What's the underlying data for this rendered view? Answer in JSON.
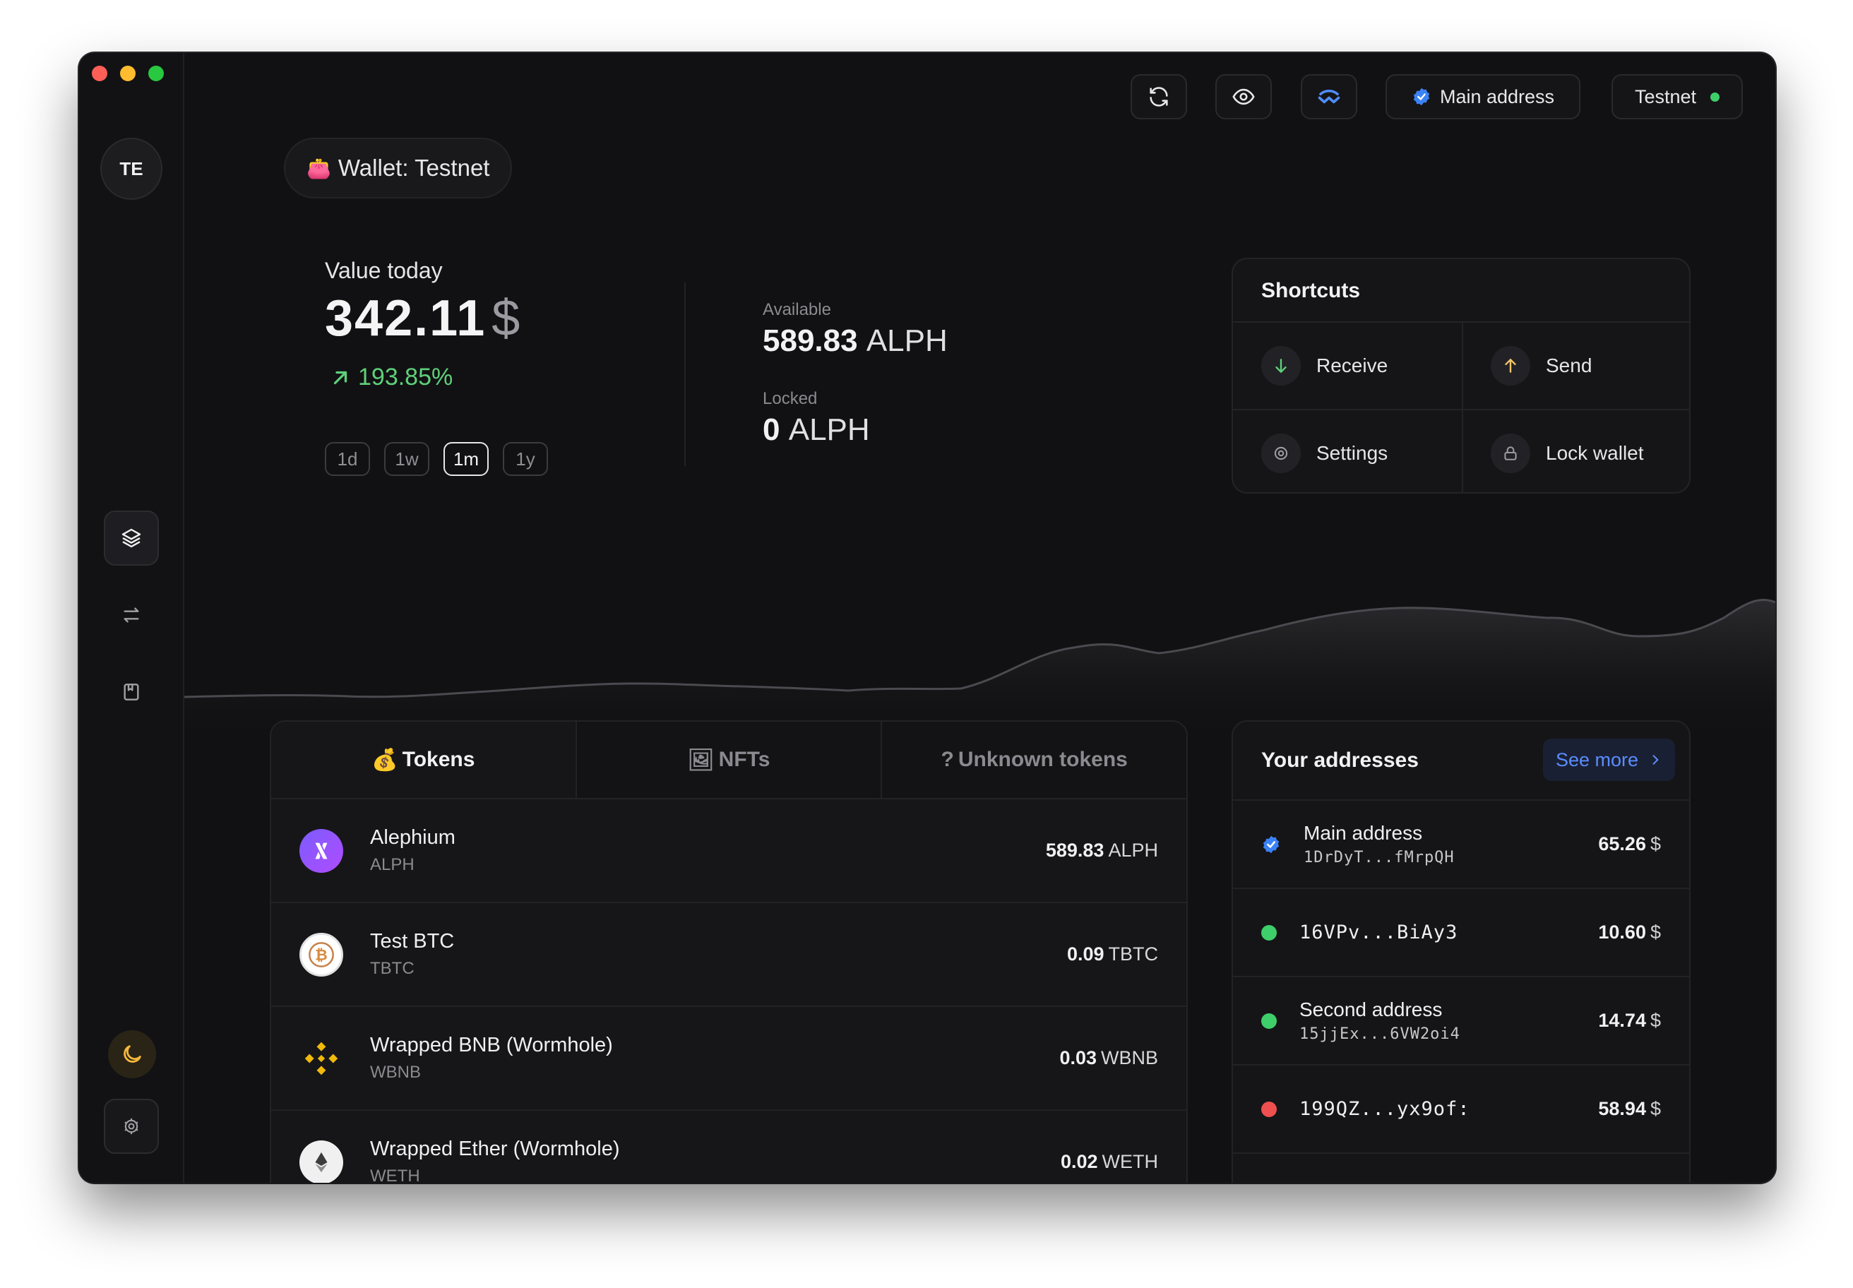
{
  "sidebar": {
    "avatar_initials": "TE"
  },
  "topbar": {
    "address_label": "Main address",
    "network_label": "Testnet",
    "network_status_color": "#3ecf6b"
  },
  "wallet": {
    "pill_label": "Wallet: Testnet",
    "pill_emoji": "👛"
  },
  "overview": {
    "value_label": "Value today",
    "value_amount": "342.11",
    "value_currency": "$",
    "change": "193.85%",
    "ranges": [
      "1d",
      "1w",
      "1m",
      "1y"
    ],
    "active_range": "1m",
    "available_label": "Available",
    "available_amount": "589.83",
    "available_unit": "ALPH",
    "locked_label": "Locked",
    "locked_amount": "0",
    "locked_unit": "ALPH"
  },
  "shortcuts": {
    "title": "Shortcuts",
    "items": [
      {
        "label": "Receive",
        "icon": "arrow-down-icon"
      },
      {
        "label": "Send",
        "icon": "arrow-up-icon"
      },
      {
        "label": "Settings",
        "icon": "gear-icon"
      },
      {
        "label": "Lock wallet",
        "icon": "lock-icon"
      }
    ]
  },
  "tabs": [
    {
      "label": "Tokens",
      "emoji": "💰"
    },
    {
      "label": "NFTs",
      "emoji": "🖼"
    },
    {
      "label": "Unknown tokens",
      "emoji": "?"
    }
  ],
  "tokens": [
    {
      "name": "Alephium",
      "symbol": "ALPH",
      "amount": "589.83",
      "unit": "ALPH"
    },
    {
      "name": "Test BTC",
      "symbol": "TBTC",
      "amount": "0.09",
      "unit": "TBTC"
    },
    {
      "name": "Wrapped BNB (Wormhole)",
      "symbol": "WBNB",
      "amount": "0.03",
      "unit": "WBNB"
    },
    {
      "name": "Wrapped Ether (Wormhole)",
      "symbol": "WETH",
      "amount": "0.02",
      "unit": "WETH"
    }
  ],
  "addresses": {
    "title": "Your addresses",
    "see_more": "See more",
    "items": [
      {
        "label": "Main address",
        "hash": "1DrDyT...fMrpQH",
        "value": "65.26",
        "unit": "$",
        "color": "#3b82f6"
      },
      {
        "label": "",
        "hash": "16VPv...BiAy3",
        "value": "10.60",
        "unit": "$",
        "color": "#3ecf6b"
      },
      {
        "label": "Second address",
        "hash": "15jjEx...6VW2oi4",
        "value": "14.74",
        "unit": "$",
        "color": "#3ecf6b"
      },
      {
        "label": "",
        "hash": "199QZ...yx9of:",
        "value": "58.94",
        "unit": "$",
        "color": "#ef4f4f"
      }
    ]
  },
  "colors": {
    "accent_blue": "#3b82f6",
    "positive": "#5fd07a",
    "theme_icon": "#f5b73a"
  }
}
